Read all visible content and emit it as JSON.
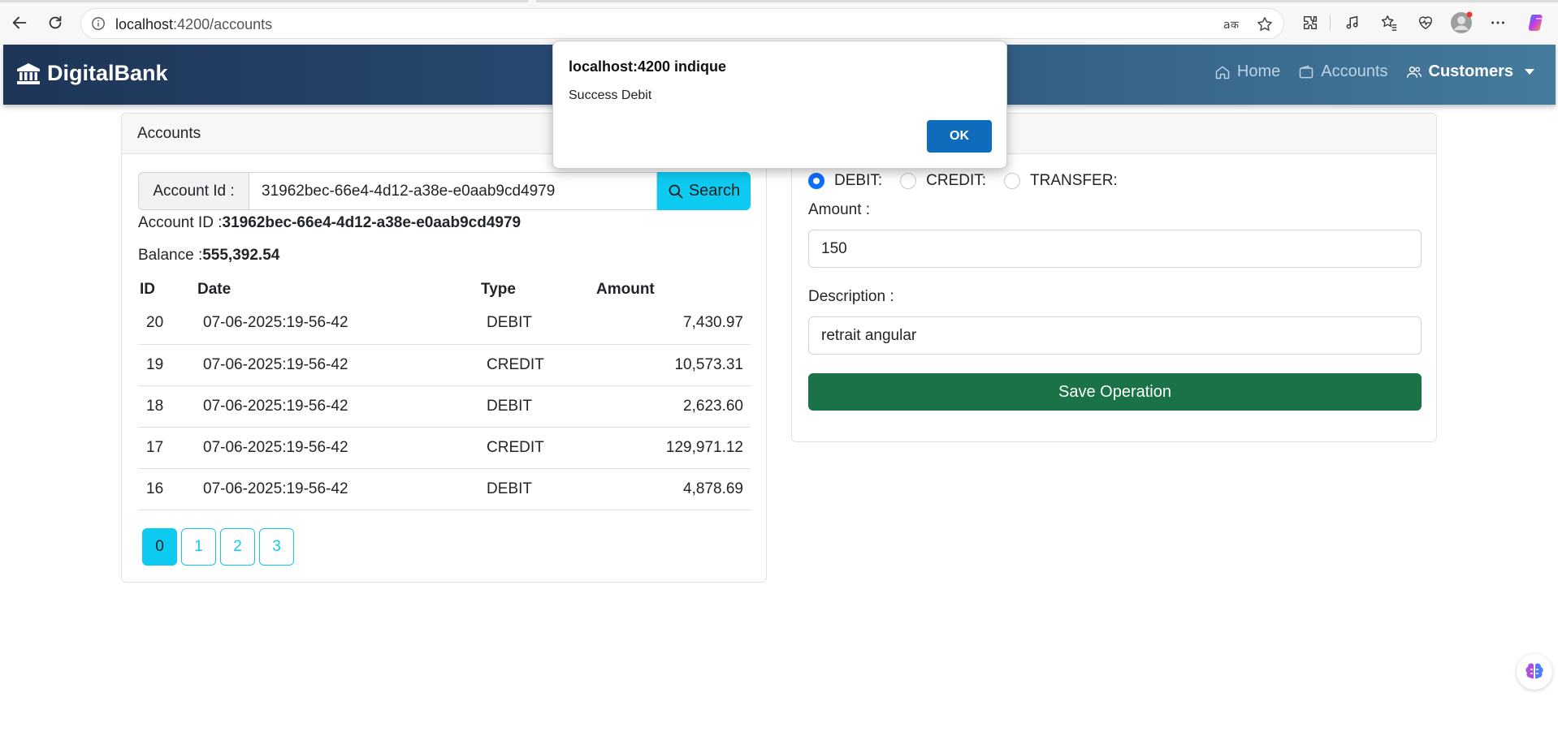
{
  "browser": {
    "url_host": "localhost",
    "url_path": ":4200/accounts"
  },
  "navbar": {
    "brand": "DigitalBank",
    "links": {
      "home": "Home",
      "accounts": "Accounts",
      "customers": "Customers"
    }
  },
  "accounts_card": {
    "header": "Accounts",
    "search_label": "Account Id :",
    "search_value": "31962bec-66e4-4d12-a38e-e0aab9cd4979",
    "search_button": "Search",
    "account_id_label": "Account ID :",
    "account_id_value": "31962bec-66e4-4d12-a38e-e0aab9cd4979",
    "balance_label": "Balance :",
    "balance_value": "555,392.54",
    "table": {
      "headers": [
        "ID",
        "Date",
        "Type",
        "Amount"
      ],
      "rows": [
        {
          "id": "20",
          "date": "07-06-2025:19-56-42",
          "type": "DEBIT",
          "amount": "7,430.97"
        },
        {
          "id": "19",
          "date": "07-06-2025:19-56-42",
          "type": "CREDIT",
          "amount": "10,573.31"
        },
        {
          "id": "18",
          "date": "07-06-2025:19-56-42",
          "type": "DEBIT",
          "amount": "2,623.60"
        },
        {
          "id": "17",
          "date": "07-06-2025:19-56-42",
          "type": "CREDIT",
          "amount": "129,971.12"
        },
        {
          "id": "16",
          "date": "07-06-2025:19-56-42",
          "type": "DEBIT",
          "amount": "4,878.69"
        }
      ]
    },
    "pages": [
      "0",
      "1",
      "2",
      "3"
    ],
    "active_page": "0"
  },
  "operations_card": {
    "radio_debit": "DEBIT:",
    "radio_credit": "CREDIT:",
    "radio_transfer": "TRANSFER:",
    "selected_operation": "DEBIT",
    "amount_label": "Amount :",
    "amount_value": "150",
    "description_label": "Description :",
    "description_value": "retrait angular",
    "save_button": "Save Operation"
  },
  "dialog": {
    "title": "localhost:4200 indique",
    "message": "Success Debit",
    "ok_button": "OK"
  },
  "colors": {
    "accent": "#0dcaf0",
    "save": "#197346",
    "navbar_start": "#1d3557",
    "navbar_end": "#457b9d",
    "dialog_ok": "#0f6cbd"
  }
}
